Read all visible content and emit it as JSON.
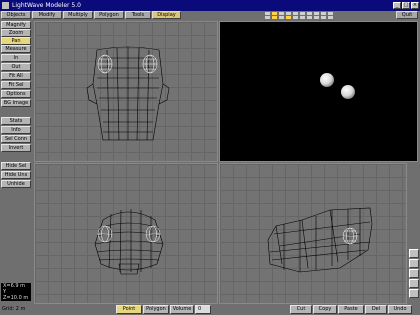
{
  "window": {
    "title": "LightWave Modeler 5.0"
  },
  "tabs": [
    {
      "label": "Objects",
      "active": false
    },
    {
      "label": "Modify",
      "active": false
    },
    {
      "label": "Multiply",
      "active": false
    },
    {
      "label": "Polygon",
      "active": false
    },
    {
      "label": "Tools",
      "active": false
    },
    {
      "label": "Display",
      "active": true
    }
  ],
  "quit_label": "Quit",
  "sidebar": {
    "buttons": [
      {
        "label": "Magnify",
        "active": false
      },
      {
        "label": "Zoom",
        "active": false
      },
      {
        "label": "Pan",
        "active": true
      },
      {
        "label": "Measure",
        "active": false
      },
      {
        "label": "In",
        "active": false
      },
      {
        "label": "Out",
        "active": false
      },
      {
        "label": "Fit All",
        "active": false
      },
      {
        "label": "Fit Sel",
        "active": false
      },
      {
        "label": "Options",
        "active": false
      },
      {
        "label": "BG Image",
        "active": false
      },
      {
        "label": "Stats",
        "active": false
      },
      {
        "label": "Info",
        "active": false
      },
      {
        "label": "Sel Conn",
        "active": false
      },
      {
        "label": "Invert",
        "active": false
      },
      {
        "label": "Hide Sel",
        "active": false
      },
      {
        "label": "Hide Uns",
        "active": false
      },
      {
        "label": "Unhide",
        "active": false
      }
    ]
  },
  "coords": {
    "x": "X=6.9 m",
    "y": "Y",
    "z": "Z=10.0 m"
  },
  "bottom": {
    "grid_label": "Grid: 2 m",
    "mode_buttons": [
      {
        "label": "Point",
        "active": true
      },
      {
        "label": "Polygon",
        "active": false
      },
      {
        "label": "Volume",
        "active": false
      }
    ],
    "selection_count": "0",
    "edit_buttons": [
      {
        "label": "Cut"
      },
      {
        "label": "Copy"
      },
      {
        "label": "Paste"
      },
      {
        "label": "Del"
      },
      {
        "label": "Undo"
      }
    ]
  },
  "colors": {
    "active_button": "#e6d67e",
    "titlebar": "#0a0a7a",
    "wireframe": "#000000",
    "spheres_render": "#e8e8e8"
  }
}
